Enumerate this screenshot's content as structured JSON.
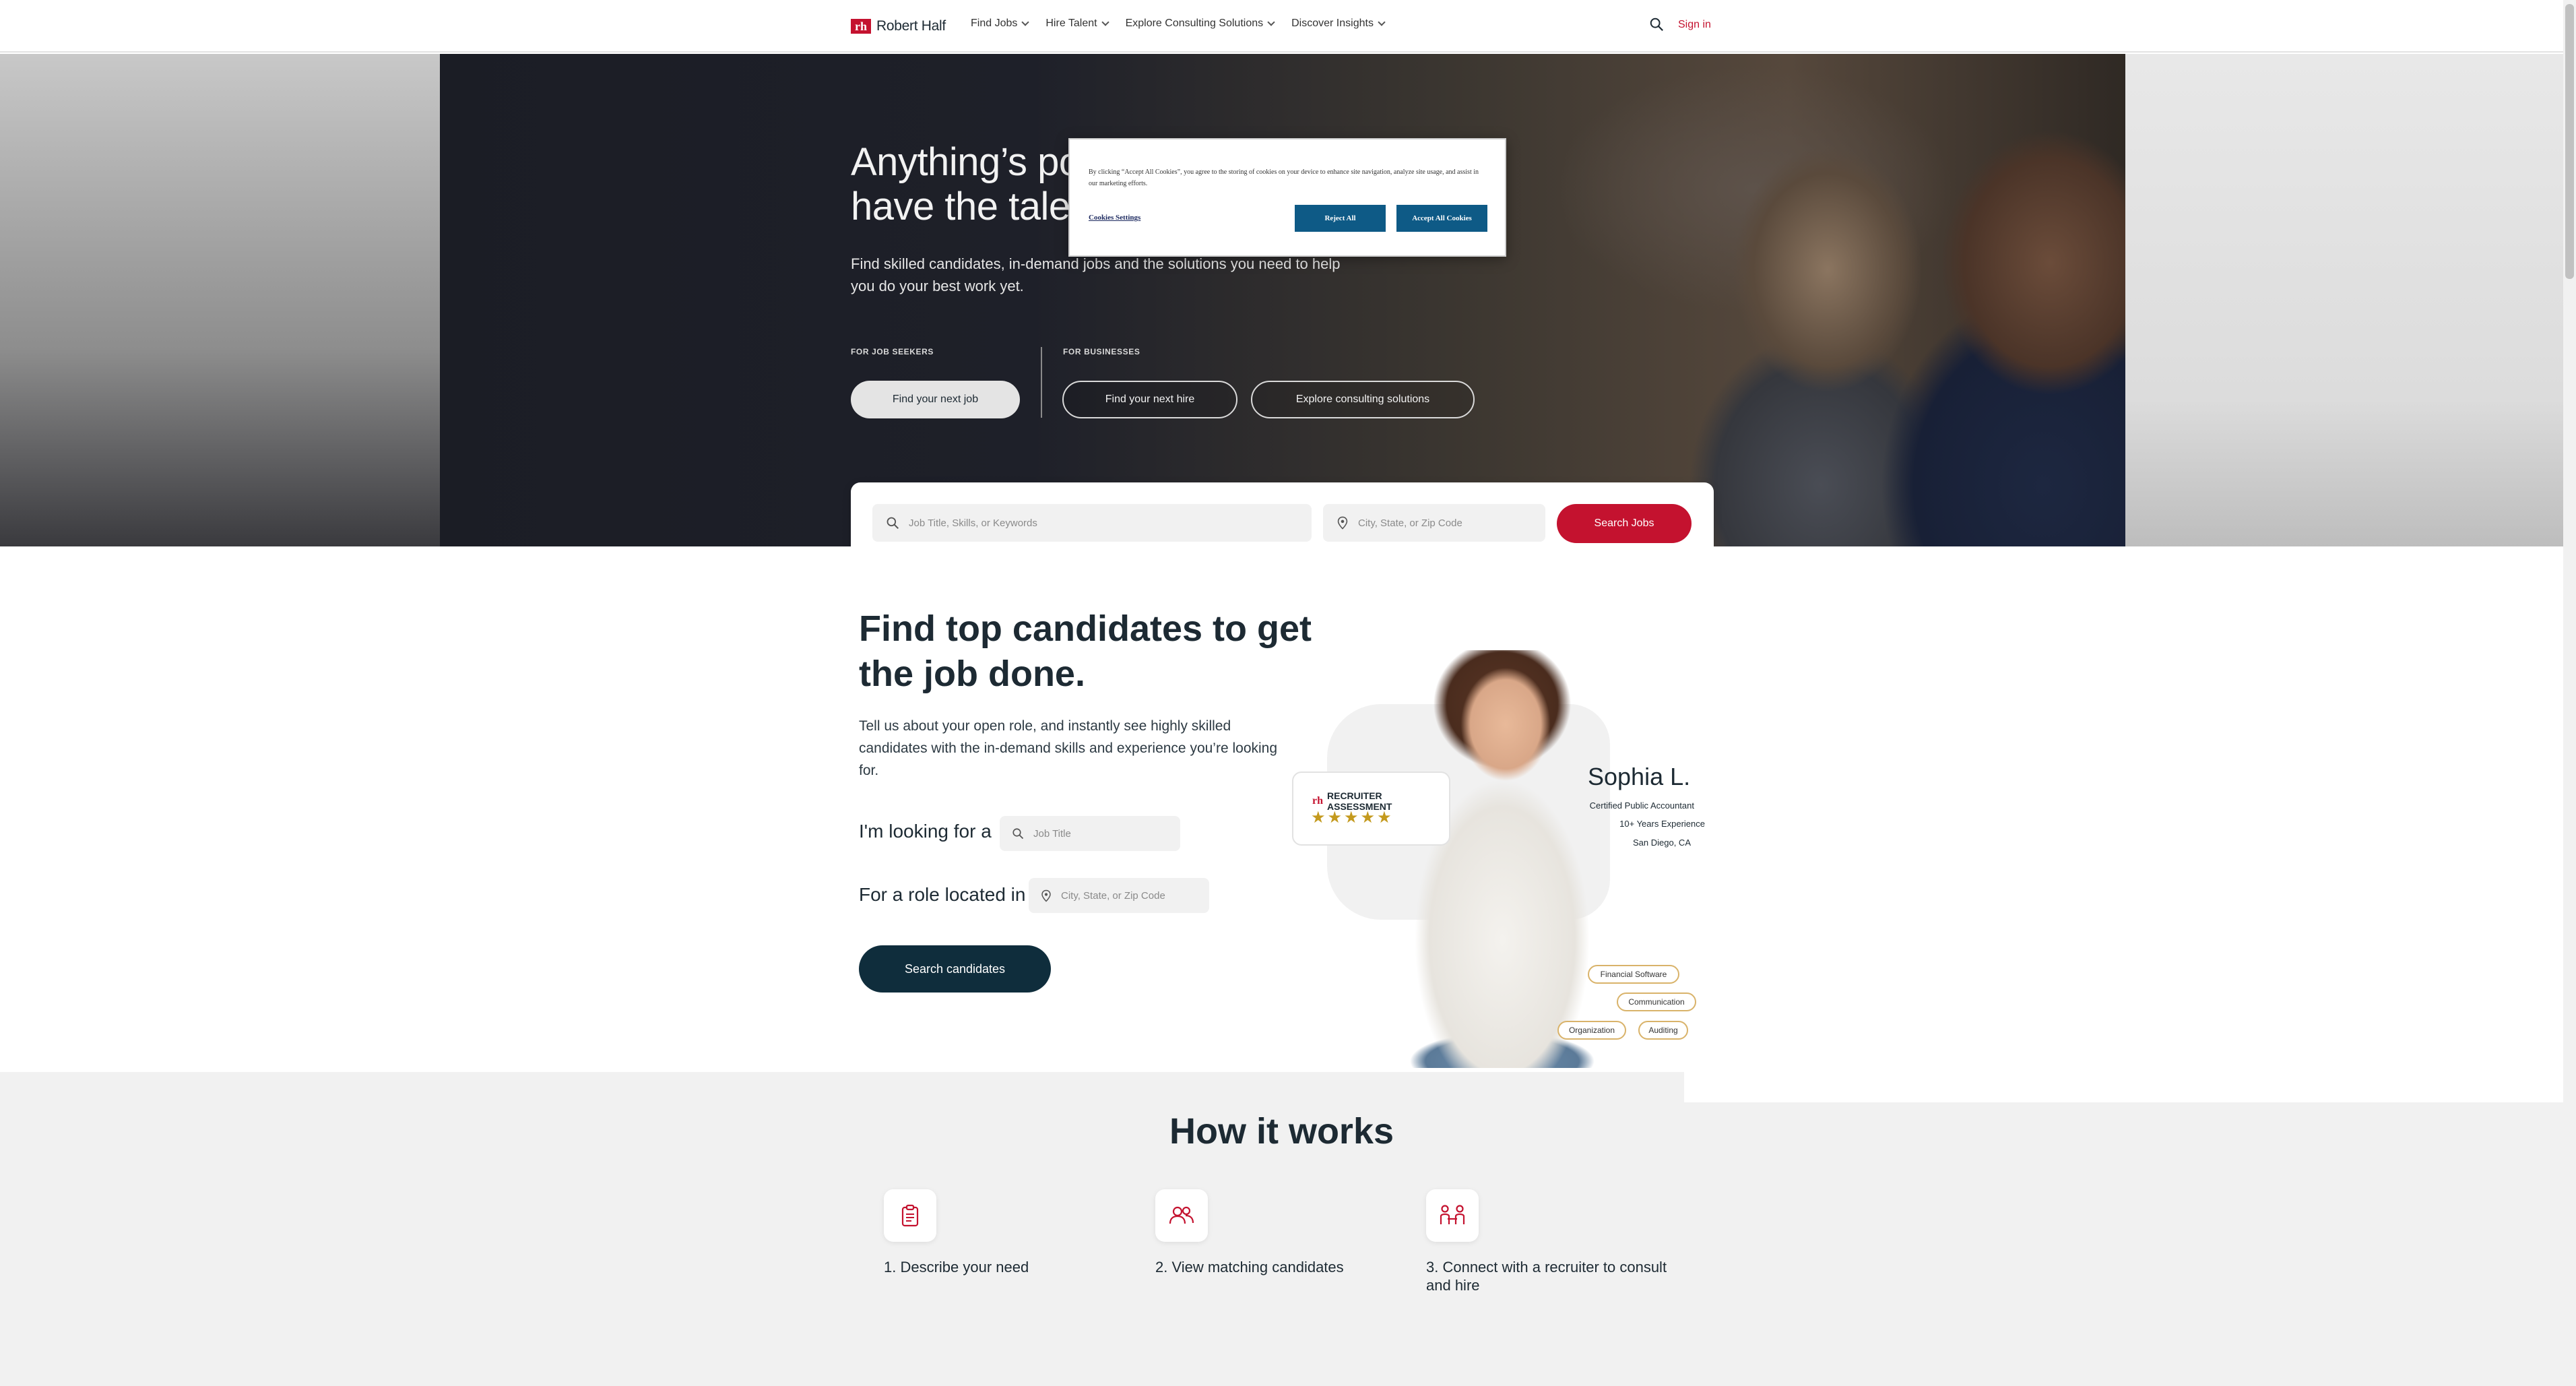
{
  "header": {
    "logo_mark": "rh",
    "logo_text": "Robert Half",
    "nav": [
      {
        "label": "Find Jobs"
      },
      {
        "label": "Hire Talent"
      },
      {
        "label": "Explore Consulting Solutions"
      },
      {
        "label": "Discover Insights"
      }
    ],
    "signin": "Sign in"
  },
  "hero": {
    "title": "Anything’s possible when you have the talent.",
    "title_line1": "Anything’s po",
    "title_line2": "have the taler",
    "subtitle": "Find skilled candidates, in-demand jobs and the solutions you need to help you do your best work yet.",
    "job_seekers_label": "FOR JOB SEEKERS",
    "businesses_label": "FOR BUSINESSES",
    "find_job": "Find your next job",
    "find_hire": "Find your next hire",
    "explore_consulting": "Explore consulting solutions"
  },
  "job_search": {
    "keywords_placeholder": "Job Title, Skills, or Keywords",
    "location_placeholder": "City, State, or Zip Code",
    "button": "Search Jobs"
  },
  "candidates": {
    "title": "Find top candidates to get the job done.",
    "subtitle": "Tell us about your open role, and instantly see highly skilled candidates with the in-demand skills and experience you’re looking for.",
    "looking_for_label": "I'm looking for a",
    "job_title_placeholder": "Job Title",
    "located_in_label": "For a role located in",
    "location_placeholder": "City, State, or Zip Code",
    "button": "Search candidates"
  },
  "profile_card": {
    "assessment_label": "RECRUITER ASSESSMENT",
    "assessment_mark": "rh",
    "rating": 5,
    "name": "Sophia L.",
    "title": "Certified Public Accountant",
    "experience": "10+ Years Experience",
    "location": "San Diego, CA",
    "skills": [
      "Financial Software",
      "Communication",
      "Organization",
      "Auditing"
    ]
  },
  "how_it_works": {
    "title": "How it works",
    "steps": [
      {
        "label": "1. Describe your need",
        "icon": "clipboard-icon"
      },
      {
        "label": "2. View matching candidates",
        "icon": "people-icon"
      },
      {
        "label": "3. Connect with a recruiter to consult and hire",
        "icon": "meeting-icon"
      }
    ]
  },
  "cookie_modal": {
    "text": "By clicking “Accept All Cookies”, you agree to the storing of cookies on your device to enhance site navigation, analyze site usage, and assist in our marketing efforts.",
    "settings": "Cookies Settings",
    "reject": "Reject All",
    "accept": "Accept All Cookies"
  },
  "colors": {
    "brand_red": "#c4122f",
    "dark_navy": "#0f2d3c",
    "cookie_blue": "#0e5a86",
    "star_gold": "#c49a1e"
  }
}
